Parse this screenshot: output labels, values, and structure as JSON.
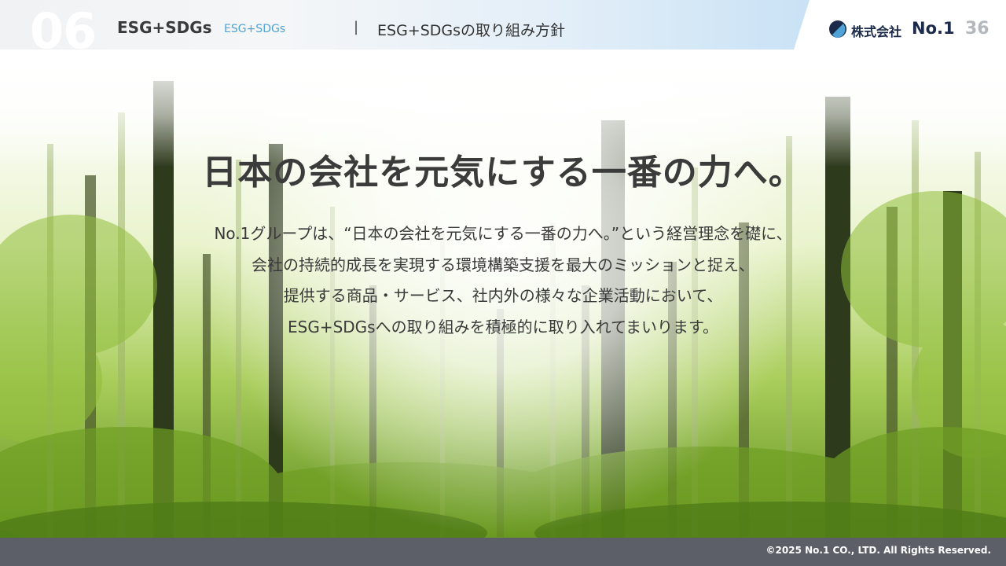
{
  "header": {
    "section_number": "06",
    "section_title": "ESG+SDGs",
    "section_subtitle": "ESG+SDGs",
    "separator": "|",
    "page_heading": "ESG+SDGsの取り組み方針",
    "company_name": "株式会社",
    "company_suffix": "No.1",
    "page_number": "36"
  },
  "main": {
    "headline": "日本の会社を元気にする一番の力へ。",
    "body_lines": [
      "No.1グループは、“日本の会社を元気にする一番の力へ。”という経営理念を礎に、",
      "会社の持続的成長を実現する環境構築支援を最大のミッションと捉え、",
      "提供する商品・サービス、社内外の様々な企業活動において、",
      "ESG+SDGsへの取り組みを積極的に取り入れてまいります。"
    ]
  },
  "footer": {
    "copyright": "©2025 No.1 CO., LTD. All Rights Reserved."
  },
  "colors": {
    "accent": "#4fa3d6",
    "brand_navy": "#1b2a4a",
    "footer_bg": "#5c5e68"
  }
}
